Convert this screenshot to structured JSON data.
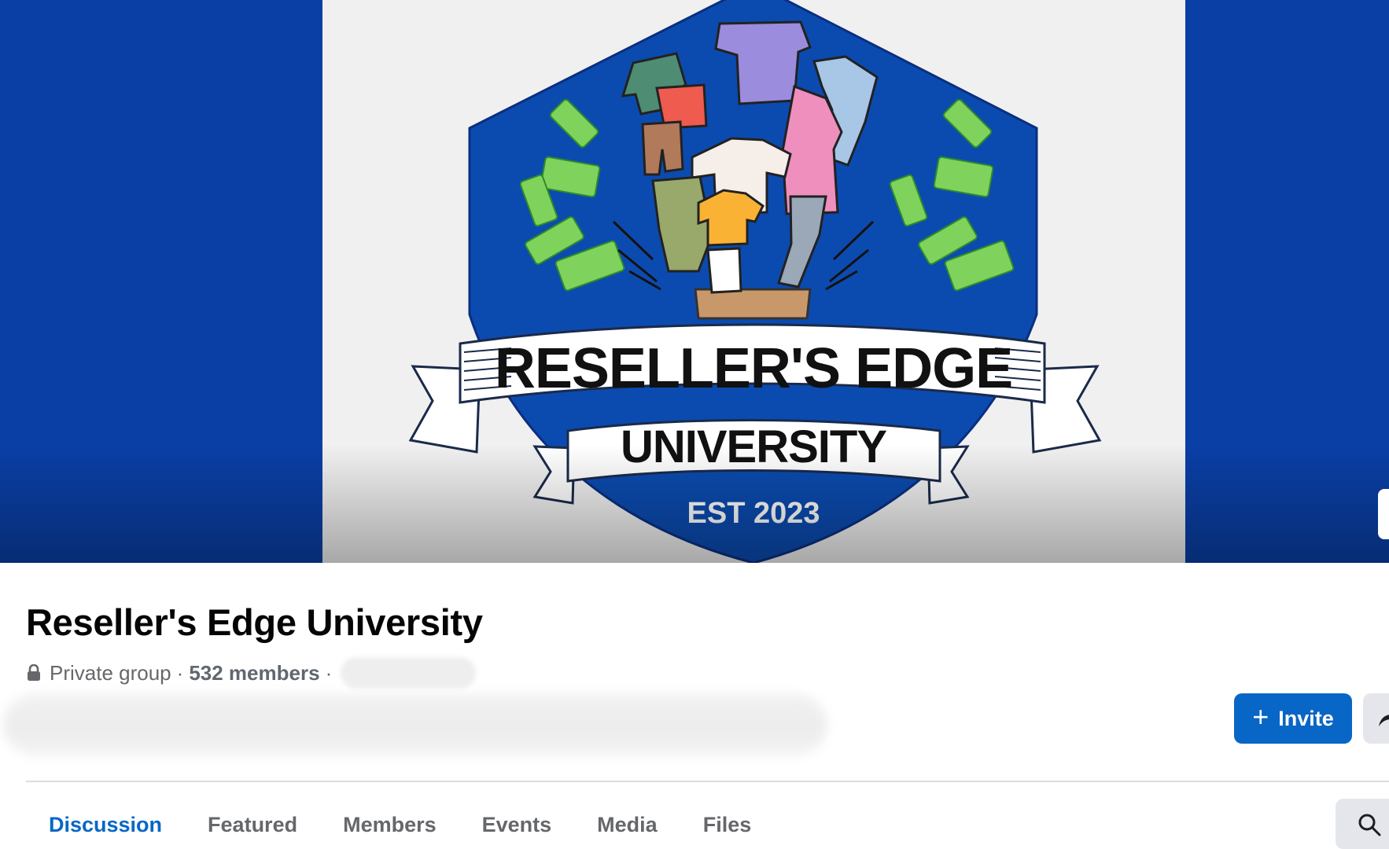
{
  "cover": {
    "badge_title": "RESELLER'S EDGE",
    "badge_subtitle": "UNIVERSITY",
    "badge_est": "EST 2023",
    "colors": {
      "banner_blue": "#0a3fa6",
      "shield_blue": "#0b4bb0",
      "photo_bg": "#f0f0f0"
    }
  },
  "group": {
    "name": "Reseller's Edge University",
    "privacy": "Private group",
    "separator": "·",
    "members": "532 members"
  },
  "actions": {
    "invite_label": "Invite",
    "invite_icon": "plus-icon",
    "share_icon": "share-icon"
  },
  "tabs": [
    {
      "label": "Discussion",
      "active": true
    },
    {
      "label": "Featured",
      "active": false
    },
    {
      "label": "Members",
      "active": false
    },
    {
      "label": "Events",
      "active": false
    },
    {
      "label": "Media",
      "active": false
    },
    {
      "label": "Files",
      "active": false
    }
  ],
  "search": {
    "icon": "search-icon"
  },
  "colors": {
    "accent": "#0866c6",
    "text": "#050505",
    "muted": "#65676b",
    "button_gray": "#e4e6eb"
  }
}
